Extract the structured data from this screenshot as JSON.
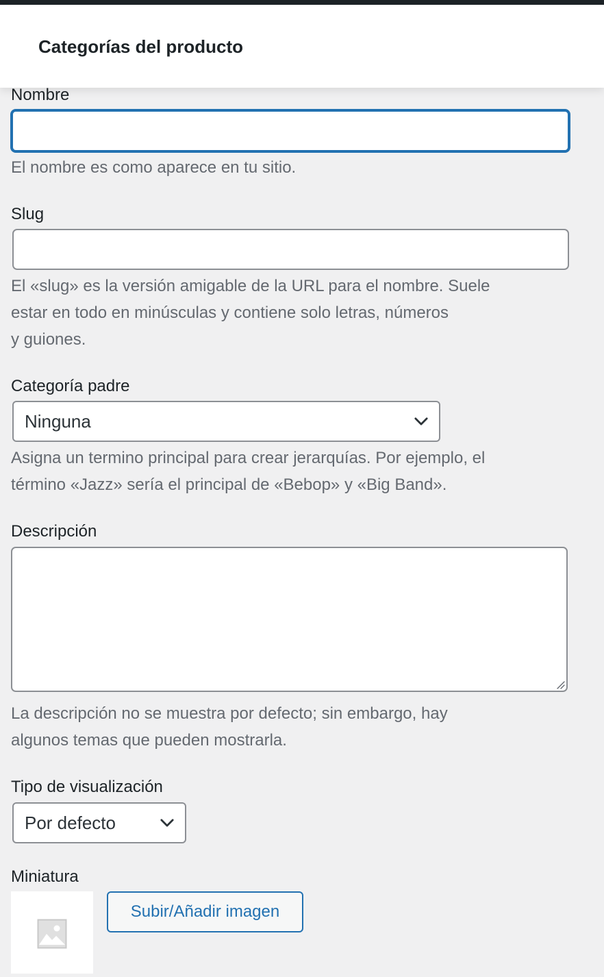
{
  "header": {
    "title": "Categorías del producto"
  },
  "form": {
    "name": {
      "label": "Nombre",
      "value": "",
      "help": "El nombre es como aparece en tu sitio."
    },
    "slug": {
      "label": "Slug",
      "value": "",
      "help_lines": [
        "El «slug» es la versión amigable de la URL para el nombre. Suele",
        "estar en todo en minúsculas y contiene solo letras, números",
        "y guiones."
      ]
    },
    "parent": {
      "label": "Categoría padre",
      "selected": "Ninguna",
      "help_lines": [
        "Asigna un termino principal para crear jerarquías. Por ejemplo, el",
        "término «Jazz» sería el principal de «Bebop» y «Big Band»."
      ]
    },
    "description": {
      "label": "Descripción",
      "value": "",
      "help_lines": [
        "La descripción no se muestra por defecto; sin embargo, hay",
        "algunos temas que pueden mostrarla."
      ]
    },
    "display_type": {
      "label": "Tipo de visualización",
      "selected": "Por defecto"
    },
    "thumbnail": {
      "label": "Miniatura",
      "placeholder_icon": "image-placeholder-icon",
      "upload_button": "Subir/Añadir imagen"
    }
  },
  "colors": {
    "accent": "#2271b1",
    "background": "#f0f0f1",
    "help_text": "#646970",
    "admin_bar": "#1d2327"
  }
}
